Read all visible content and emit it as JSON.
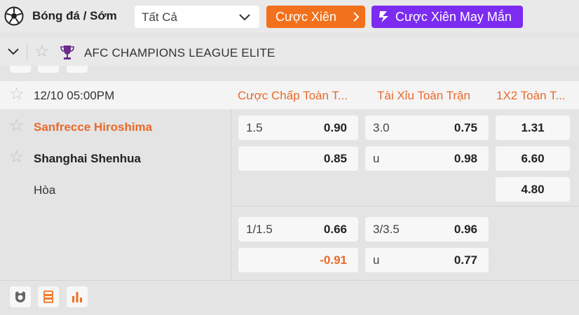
{
  "header": {
    "sport_title": "Bóng đá / Sớm",
    "filter_value": "Tất Cả",
    "parlay_button": "Cược Xiên",
    "lucky_parlay_button": "Cược Xiên May Mắn"
  },
  "league": {
    "name": "AFC CHAMPIONS LEAGUE ELITE"
  },
  "match": {
    "datetime": "12/10 05:00PM",
    "columns": [
      "Cược Chấp Toàn T...",
      "Tài Xỉu Toàn Trận",
      "1X2 Toàn T..."
    ],
    "home": "Sanfrecce Hiroshima",
    "away": "Shanghai Shenhua",
    "draw": "Hòa",
    "lines": [
      {
        "handicap": {
          "line": "1.5",
          "home_odds": "0.90",
          "away_odds": "0.85"
        },
        "total": {
          "line": "3.0",
          "over_odds": "0.75",
          "under_label": "u",
          "under_odds": "0.98"
        },
        "x12": {
          "home": "1.31",
          "away": "6.60",
          "draw": "4.80"
        }
      },
      {
        "handicap": {
          "line": "1/1.5",
          "home_odds": "0.66",
          "away_odds": "-0.91"
        },
        "total": {
          "line": "3/3.5",
          "over_odds": "0.96",
          "under_label": "u",
          "under_odds": "0.77"
        }
      }
    ]
  },
  "colors": {
    "accent_orange": "#f2711c",
    "accent_purple": "#7b2cf0",
    "home_team": "#e8692a",
    "negative_odds": "#e8692a"
  },
  "icons": {
    "sport": "soccer-ball-icon",
    "league": "trophy-icon",
    "footer": [
      "stats-badge-icon",
      "match-list-icon",
      "bar-chart-icon"
    ]
  }
}
